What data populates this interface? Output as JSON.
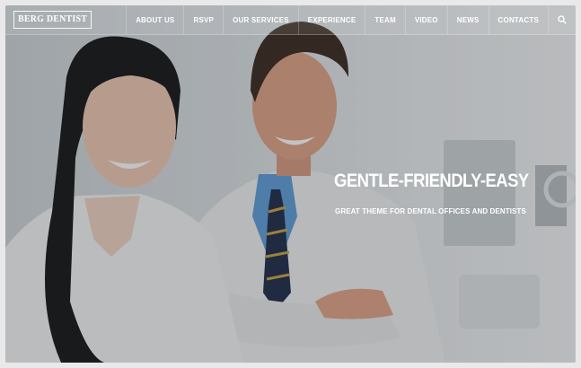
{
  "header": {
    "logo_text": "BERG DENTIST",
    "nav": [
      {
        "label": "ABOUT US"
      },
      {
        "label": "RSVP"
      },
      {
        "label": "OUR SERVICES"
      },
      {
        "label": "EXPERIENCE"
      },
      {
        "label": "TEAM"
      },
      {
        "label": "VIDEO"
      },
      {
        "label": "NEWS"
      },
      {
        "label": "CONTACTS"
      }
    ],
    "search_icon": "search-icon"
  },
  "hero": {
    "title": "GENTLE-FRIENDLY-EASY",
    "subtitle": "GREAT THEME FOR DENTAL OFFICES AND DENTISTS"
  },
  "colors": {
    "overlay": "#23262a",
    "text": "#ffffff"
  }
}
